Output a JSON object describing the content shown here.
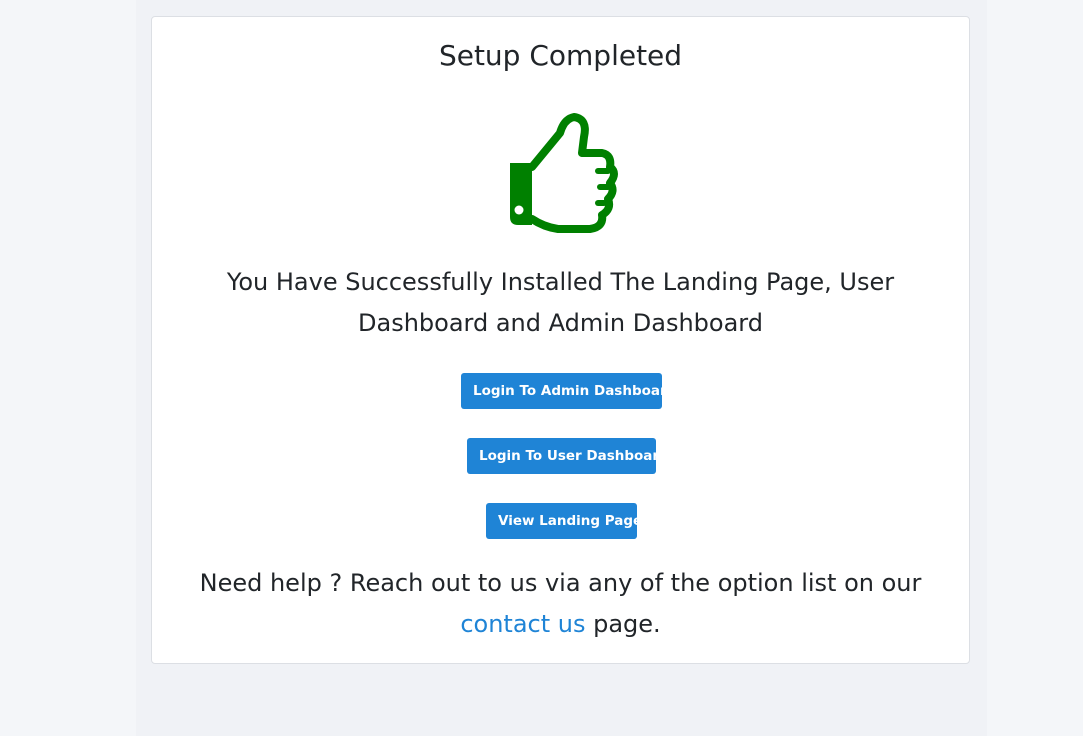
{
  "setup": {
    "title": "Setup Completed",
    "message": "You Have Successfully Installed The Landing Page, User Dashboard and Admin Dashboard",
    "buttons": {
      "admin_label": "Login To Admin Dashboard",
      "user_label": "Login To User Dashboard",
      "landing_label": "View Landing Page"
    },
    "help": {
      "text_before": "Need help ? Reach out to us via any of the option list on our",
      "link_text": "contact us",
      "text_after": "page."
    },
    "icon": "thumbs-up-icon"
  },
  "colors": {
    "accent": "#1f84d6",
    "success": "#008000",
    "background": "#f4f6f9"
  }
}
